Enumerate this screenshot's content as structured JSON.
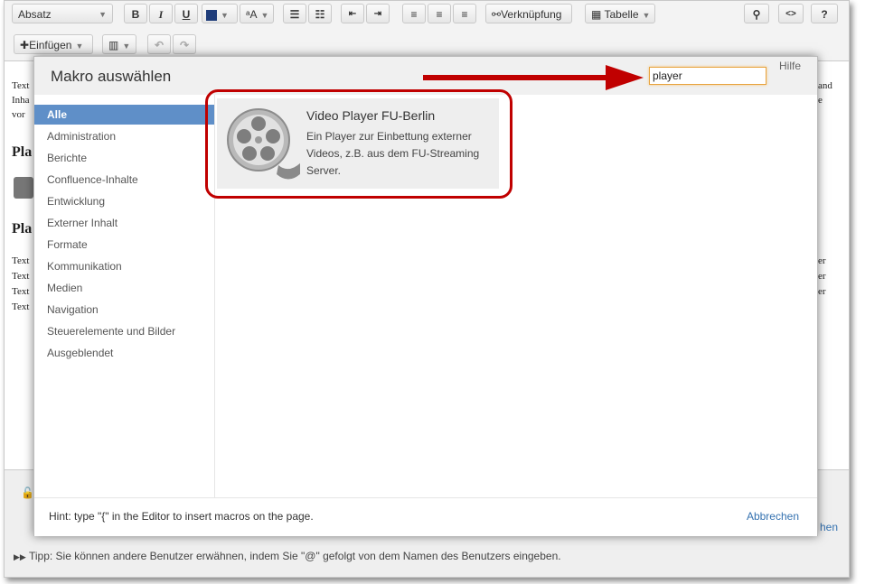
{
  "toolbar": {
    "style_select": "Absatz",
    "bold": "B",
    "italic": "I",
    "underline": "U",
    "text_style": "ᵃA",
    "link": "Verknüpfung",
    "table": "Tabelle",
    "source": "<>",
    "help": "?",
    "insert": "Einfügen"
  },
  "editor": {
    "heading1": "Pla",
    "heading2": "Pla",
    "line_text": "Text",
    "line_inha": "Inha",
    "line_vor": "vor",
    "right_and": "and",
    "right_e": "e",
    "right_er": "er"
  },
  "dialog": {
    "title": "Makro auswählen",
    "help_link": "Hilfe",
    "search_value": "player",
    "categories": [
      "Alle",
      "Administration",
      "Berichte",
      "Confluence-Inhalte",
      "Entwicklung",
      "Externer Inhalt",
      "Formate",
      "Kommunikation",
      "Medien",
      "Navigation",
      "Steuerelemente und Bilder",
      "Ausgeblendet"
    ],
    "active_category": "Alle",
    "result": {
      "title": "Video Player FU-Berlin",
      "description": "Ein Player zur Einbettung externer Videos, z.B. aus dem FU-Streaming Server.",
      "icon": "film-reel-icon"
    },
    "hint": "Hint: type \"{\" in the Editor to insert macros on the page.",
    "cancel": "Abbrechen"
  },
  "page": {
    "tip": "Tipp: Sie können andere Benutzer erwähnen, indem Sie \"@\" gefolgt von dem Namen des Benutzers eingeben.",
    "link_partial": "hen"
  },
  "colors": {
    "active_category": "#5f8fc8",
    "annotation": "#c00000",
    "link": "#3572b0",
    "search_focus": "#e8a33d"
  }
}
